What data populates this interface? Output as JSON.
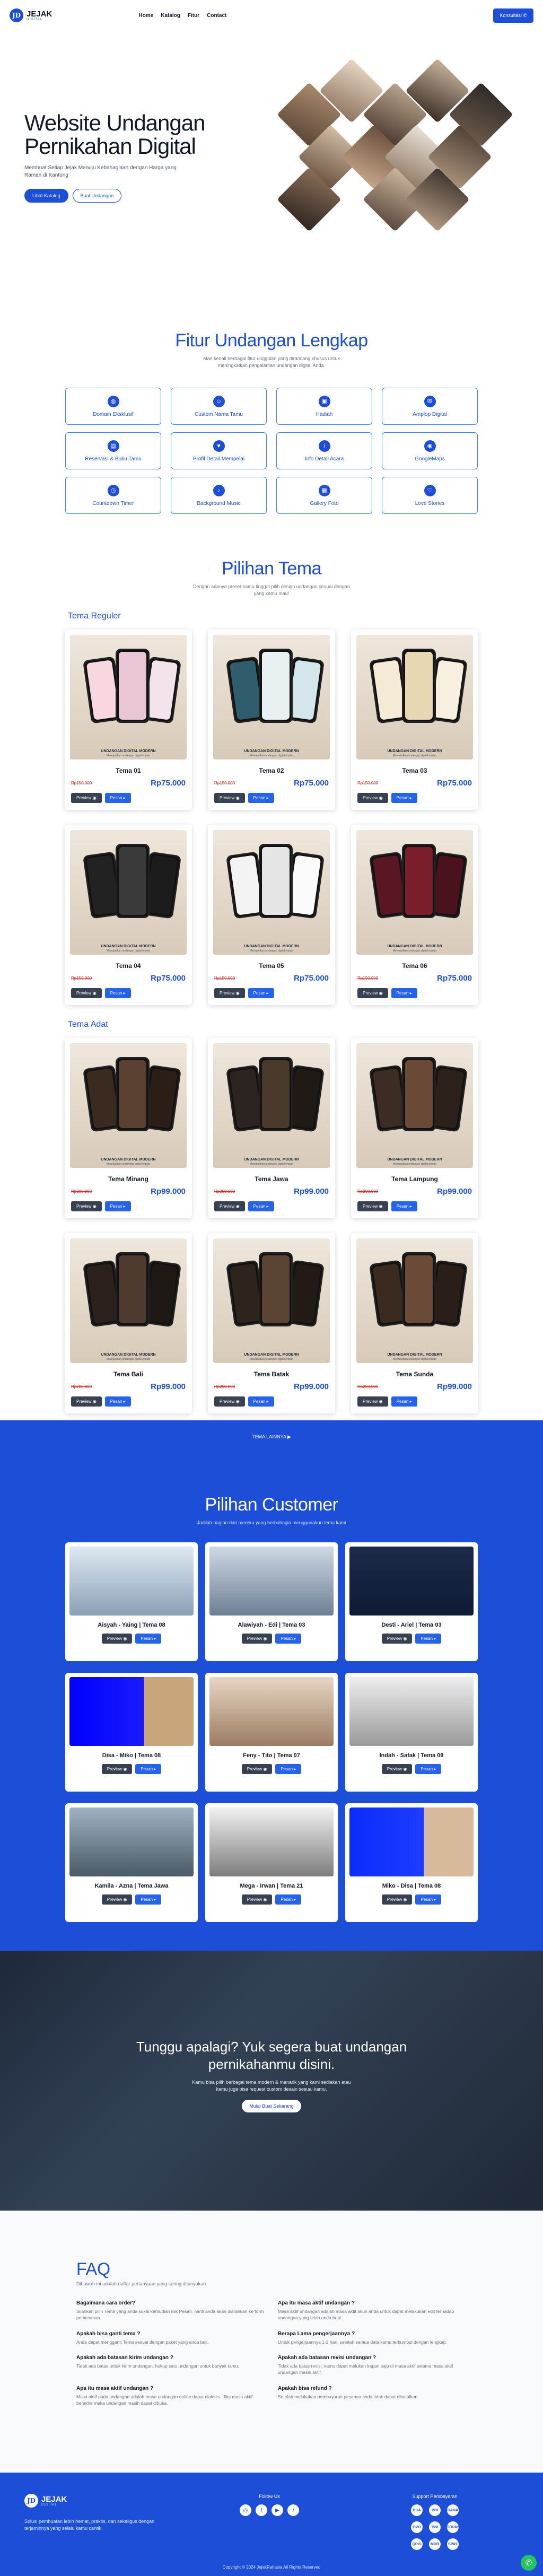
{
  "nav": {
    "brand": "JEJAK",
    "brand_sub": "DIGITAL",
    "logo_letter": "JD",
    "menu": [
      "Home",
      "Katalog",
      "Fitur",
      "Contact"
    ],
    "cta": "Konsultasi"
  },
  "hero": {
    "title": "Website Undangan Pernikahan Digital",
    "desc": "Membuat Setiap Jejak Menuju Kebahagiaan dengan Harga yang Ramah di Kantong",
    "btn_primary": "Lihat Katalog",
    "btn_secondary": "Buat Undangan"
  },
  "features": {
    "title": "Fitur Undangan Lengkap",
    "sub": "Mari kenali berbagai fitur unggulan yang dirancang khusus untuk meningkatkan pengalaman undangan digital Anda.",
    "items": [
      "Domain Eksklusif",
      "Custom Nama Tamu",
      "Hadiah",
      "Amplop Digital",
      "Reservasi & Buku Tamu",
      "Profil Detail Mempelai",
      "Info Detail Acara",
      "GoogleMaps",
      "Countdown Timer",
      "Background Music",
      "Gallery Foto",
      "Love Stories"
    ]
  },
  "tema": {
    "title": "Pilihan Tema",
    "sub": "Dengan adanya preset kamu tinggal pilih design undangan sesuai dengan yang kamu mau!",
    "reguler_label": "Tema Reguler",
    "adat_label": "Tema Adat",
    "preview": "Preview",
    "pesan": "Pesan",
    "card_caption": "UNDANGAN DIGITAL MODERN",
    "card_caption2": "Mewujudkan undangan digital impian",
    "reguler": [
      {
        "name": "Tema 01",
        "old": "Rp150.000",
        "price": "Rp75.000"
      },
      {
        "name": "Tema 02",
        "old": "Rp150.000",
        "price": "Rp75.000"
      },
      {
        "name": "Tema 03",
        "old": "Rp150.000",
        "price": "Rp75.000"
      },
      {
        "name": "Tema 04",
        "old": "Rp150.000",
        "price": "Rp75.000"
      },
      {
        "name": "Tema 05",
        "old": "Rp150.000",
        "price": "Rp75.000"
      },
      {
        "name": "Tema 06",
        "old": "Rp150.000",
        "price": "Rp75.000"
      }
    ],
    "adat": [
      {
        "name": "Tema Minang",
        "old": "Rp200.000",
        "price": "Rp99.000"
      },
      {
        "name": "Tema Jawa",
        "old": "Rp200.000",
        "price": "Rp99.000"
      },
      {
        "name": "Tema Lampung",
        "old": "Rp200.000",
        "price": "Rp99.000"
      },
      {
        "name": "Tema Bali",
        "old": "Rp200.000",
        "price": "Rp99.000"
      },
      {
        "name": "Tema Batak",
        "old": "Rp200.000",
        "price": "Rp99.000"
      },
      {
        "name": "Tema Sunda",
        "old": "Rp200.000",
        "price": "Rp99.000"
      }
    ],
    "more": "TEMA LAINNYA"
  },
  "customers": {
    "title": "Pilihan Customer",
    "sub": "Jadilah bagian dari mereka yang berbahagia menggunakan tema kami",
    "items": [
      "Aisyah - Yaing | Tema 08",
      "Alawiyah - Edi | Tema 03",
      "Desti - Ariel | Tema 03",
      "Disa - Miko | Tema 08",
      "Feny - Tito | Tema 07",
      "Indah - Safak | Tema 08",
      "Kamila - Azna | Tema Jawa",
      "Mega - Irwan | Tema 21",
      "Miko - Disa | Tema 08"
    ]
  },
  "cta": {
    "title": "Tunggu apalagi? Yuk segera buat undangan pernikahanmu disini.",
    "desc": "Kamu bisa pilih berbagai tema modern & menarik yang kami sediakan atau kamu juga bisa request custom desain sesuai kamu.",
    "btn": "Mulai Buat Sekarang"
  },
  "faq": {
    "title": "FAQ",
    "sub": "Dibawah ini adalah daftar pertanyaan yang sering ditanyakan.",
    "items": [
      {
        "q": "Bagaimana cara order?",
        "a": "Silahkan pilih Tema yang anda sukai kemudian klik Pesan, nanti anda akan diarahkan ke form pemesanan."
      },
      {
        "q": "Apa itu masa aktif undangan ?",
        "a": "Masa aktif undangan adalah masa aktif akun anda untuk dapat melakukan edit terhadap undangan yang telah anda buat."
      },
      {
        "q": "Apakah bisa ganti tema ?",
        "a": "Anda dapat mengganti Tema sesuai dengan paket yang anda beli."
      },
      {
        "q": "Berapa Lama pengerjaannya ?",
        "a": "Untuk pengerjaannya 1-2 hari, setelah semua data kamu terkumpul dengan lengkap."
      },
      {
        "q": "Apakah ada batasan kirim undangan ?",
        "a": "Tidak ada batas untuk kirim undangan, hukup satu undangan untuk banyak tamu."
      },
      {
        "q": "Apakah ada batasan revisi undangan ?",
        "a": "Tidak ada batas revisi, kamu dapat melukan kapan saja di masa aktif selama masa aktif undangan masih aktif."
      },
      {
        "q": "Apa itu masa aktif undangan ?",
        "a": "Masa aktif pada undangan adalah masa undangan online dapat diakses. Jika masa aktif berakhir maka undangan masih dapat dibuka."
      },
      {
        "q": "Apakah bisa refund ?",
        "a": "Setelah melakukan pembayaran pesanan anda tidak dapat dibatalkan."
      }
    ]
  },
  "footer": {
    "brand": "JEJAK",
    "brand_sub": "DIGITAL",
    "desc": "Solusi pembuatan lebih hemat, praktis, dan sekaligus dengan terjaminnya yang selalu kamu cantik.",
    "follow": "Follow Us",
    "socials": [
      "instagram-icon",
      "facebook-icon",
      "youtube-icon",
      "tiktok-icon"
    ],
    "pay_title": "Support Pembayaran",
    "pays": [
      "BCA",
      "BRI",
      "DANA",
      "OVO",
      "BNI",
      "GOPAY",
      "QRIS",
      "MDR",
      "SPAY"
    ],
    "copyright": "Copyright © 2024 JejakRahasia All Rights Reserved"
  },
  "colors": {
    "primary": "#1d4ed8",
    "accent": "#2563eb",
    "price_old": "#dc2626"
  }
}
